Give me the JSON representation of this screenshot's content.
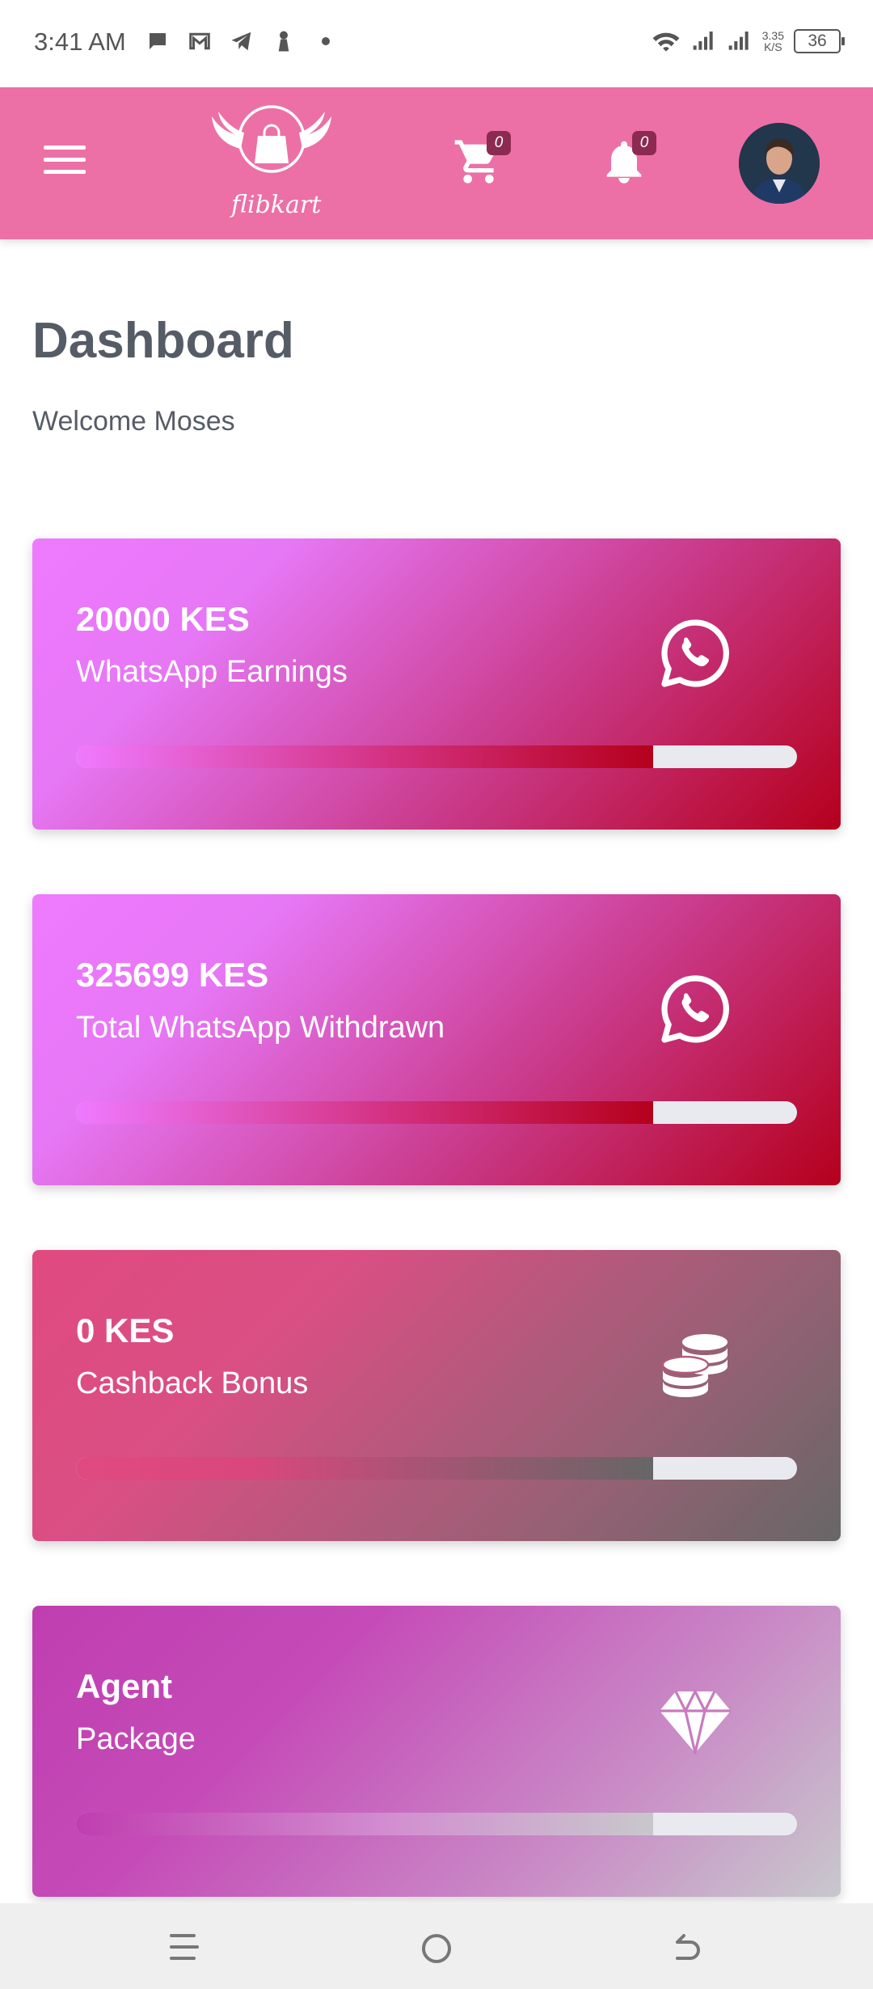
{
  "status_bar": {
    "time": "3:41 AM",
    "speed_value": "3.35",
    "speed_unit": "K/S",
    "battery": "36",
    "icons": [
      "message-icon",
      "gmail-icon",
      "telegram-icon",
      "notification-icon",
      "dot-icon",
      "wifi-icon",
      "signal-icon",
      "signal-icon-2",
      "battery-icon"
    ]
  },
  "header": {
    "logo_text": "flibkart",
    "cart_count": "0",
    "notification_count": "0",
    "icons": [
      "menu-icon",
      "cart-icon",
      "bell-icon",
      "avatar"
    ],
    "colors": {
      "header_bg": "#ec70a5",
      "badge_bg": "#8c2a52"
    }
  },
  "main": {
    "title": "Dashboard",
    "welcome": "Welcome Moses",
    "cards": [
      {
        "value": "20000 KES",
        "label": "WhatsApp Earnings",
        "icon": "whatsapp-icon",
        "progress": 0.8
      },
      {
        "value": "325699 KES",
        "label": "Total WhatsApp Withdrawn",
        "icon": "whatsapp-icon",
        "progress": 0.8
      },
      {
        "value": "0 KES",
        "label": "Cashback Bonus",
        "icon": "coins-icon",
        "progress": 0.8
      },
      {
        "value": "Agent",
        "label": "Package",
        "icon": "diamond-icon",
        "progress": 0.8
      }
    ]
  },
  "nav_bar": {
    "buttons": [
      "recents-icon",
      "home-icon",
      "back-icon"
    ]
  }
}
